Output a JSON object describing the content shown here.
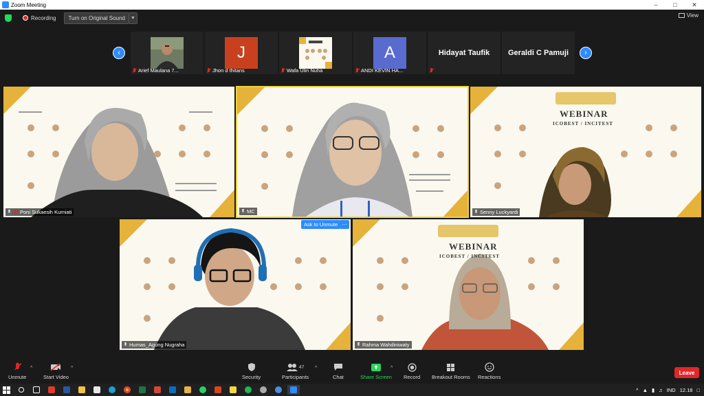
{
  "window": {
    "title": "Zoom Meeting"
  },
  "topbar": {
    "recording_label": "Recording",
    "sound_button": "Turn on Original Sound",
    "view_label": "View"
  },
  "strip": {
    "participants": [
      {
        "name": "Arief Maulana 7...",
        "kind": "photo"
      },
      {
        "name": "Jhon d thitans",
        "kind": "letter",
        "letter": "J",
        "color": "#c9401f"
      },
      {
        "name": "Wafa Ulin Nuha",
        "kind": "webinar"
      },
      {
        "name": "ANDI KEVIN HA...",
        "kind": "letter",
        "letter": "A",
        "color": "#5a6bd0"
      },
      {
        "name": "Hidayat Taufik",
        "kind": "name"
      },
      {
        "name": "Geraldi C Pamuji",
        "kind": "name"
      }
    ]
  },
  "tiles": {
    "t1": {
      "name": "Poni Sukaesih Kurniati"
    },
    "t2": {
      "name": "MC"
    },
    "t3": {
      "name": "Senny Luckyardi",
      "slide_title": "WEBINAR",
      "slide_sub": "ICOBEST / INCITEST"
    },
    "t4": {
      "name": "Humas_Agung Nugraha"
    },
    "t5": {
      "name": "Rahma Wahdiniwaty",
      "slide_title": "WEBINAR",
      "slide_sub": "ICOBEST / INCITEST"
    }
  },
  "ask_unmute": "Ask to Unmute",
  "more": "···",
  "toolbar": {
    "unmute": "Unmute",
    "start_video": "Start Video",
    "security": "Security",
    "participants": "Participants",
    "participants_count": "47",
    "chat": "Chat",
    "share_screen": "Share Screen",
    "record": "Record",
    "breakout": "Breakout Rooms",
    "reactions": "Reactions",
    "leave": "Leave"
  },
  "taskbar": {
    "lang": "IND",
    "time": "12.18"
  },
  "colors": {
    "accent": "#2d8cff",
    "leave": "#e02828",
    "share": "#23d959",
    "slide_gold": "#e5b23a"
  }
}
